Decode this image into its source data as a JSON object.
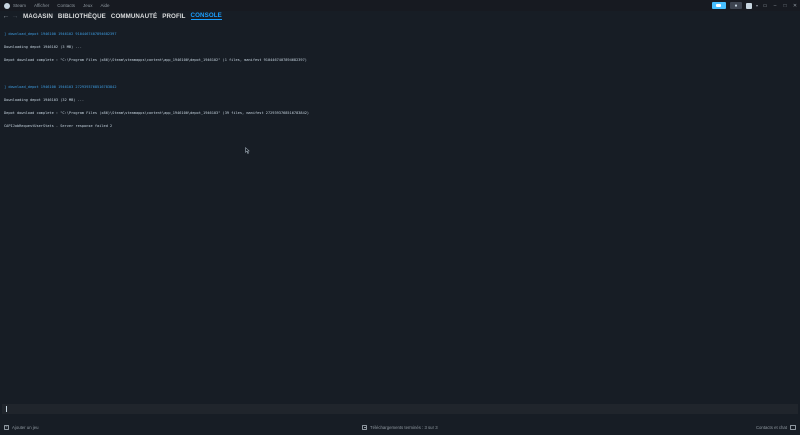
{
  "menubar": {
    "items": [
      "Steam",
      "Afficher",
      "Contacts",
      "Jeux",
      "Aide"
    ]
  },
  "navbar": {
    "tabs": [
      {
        "label": "MAGASIN",
        "active": false
      },
      {
        "label": "BIBLIOTHÈQUE",
        "active": false
      },
      {
        "label": "COMMUNAUTÉ",
        "active": false
      },
      {
        "label": "PROFIL",
        "active": false
      },
      {
        "label": "CONSOLE",
        "active": true
      }
    ]
  },
  "console": {
    "lines": [
      {
        "text": "] download_depot 1946100 1946102 9104467407894682397",
        "type": "link"
      },
      {
        "text": "Downloading depot 1946102 (3 MB) ...",
        "type": "normal"
      },
      {
        "text": "Depot download complete : \"C:\\Program Files (x86)\\Steam\\steamapps\\content\\app_1946100\\depot_1946102\" (1 files, manifest 9104467407894682397)",
        "type": "normal"
      },
      {
        "text": "",
        "type": "blank"
      },
      {
        "text": "] download_depot 1946100 1946103 2729393768516783842",
        "type": "link"
      },
      {
        "text": "Downloading depot 1946103 (32 MB) ...",
        "type": "normal"
      },
      {
        "text": "Depot download complete : \"C:\\Program Files (x86)\\Steam\\steamapps\\content\\app_1946100\\depot_1946103\" (39 files, manifest 2729393768516783842)",
        "type": "normal"
      },
      {
        "text": "CAPIJobRequestUserStats - Server response failed 2",
        "type": "normal"
      }
    ]
  },
  "input": {
    "value": ""
  },
  "bottombar": {
    "add_game": "Ajouter un jeu",
    "downloads": "Téléchargements terminés : 3 sur 3",
    "friends": "Contacts et chat"
  },
  "colors": {
    "background": "#171d25",
    "accent": "#1a9fff",
    "link": "#3d9ee4",
    "text": "#c7d5e0"
  }
}
